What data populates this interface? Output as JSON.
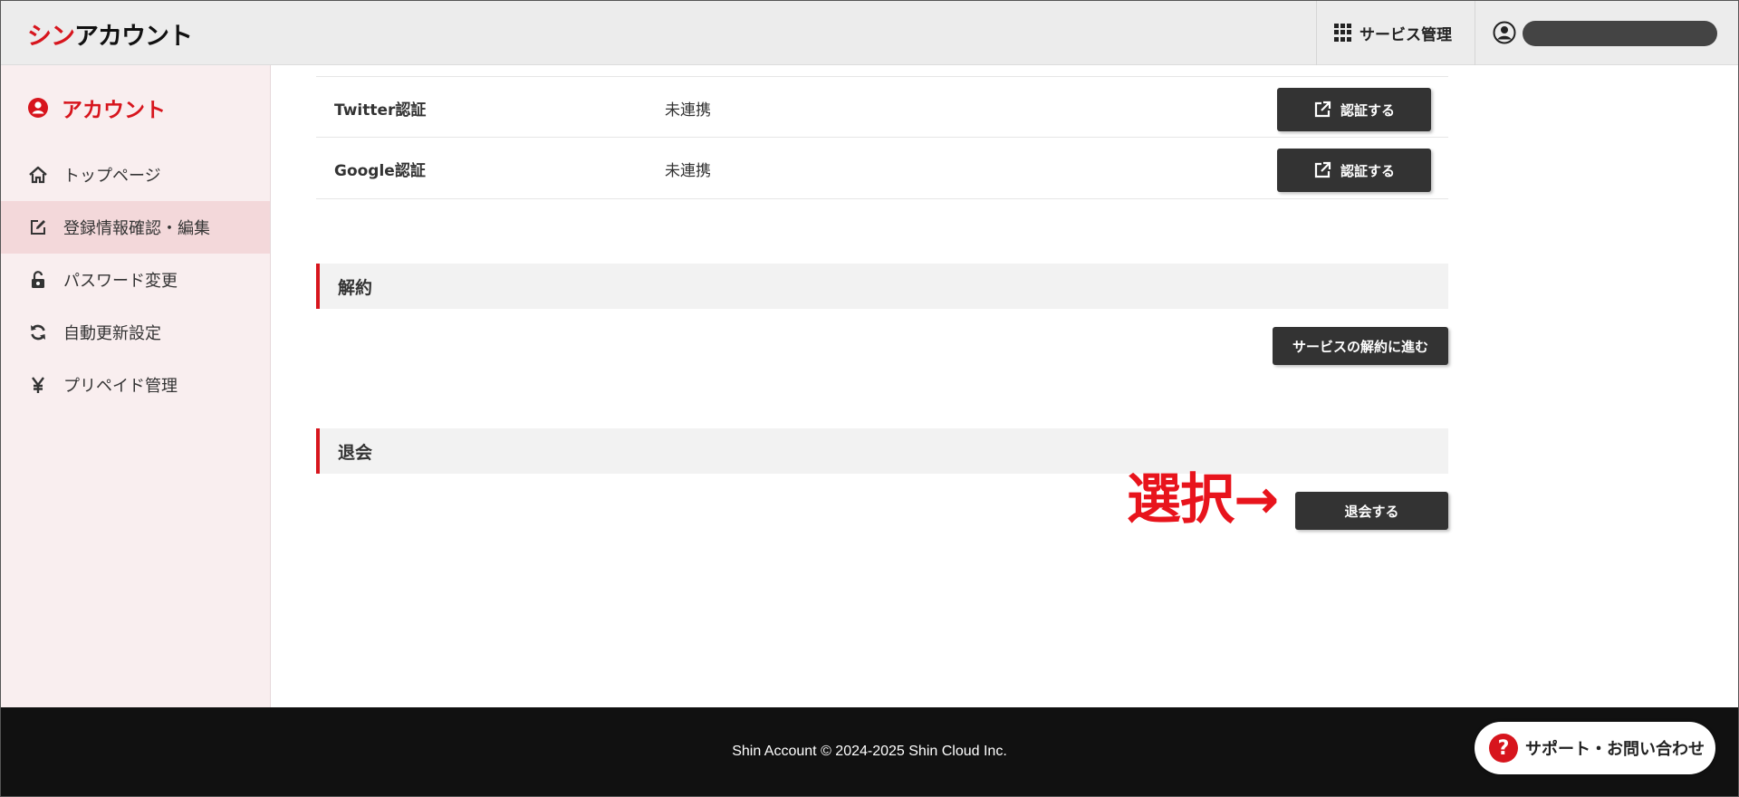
{
  "header": {
    "logo_red": "シン",
    "logo_black": "アカウント",
    "service_label": "サービス管理",
    "icons": [
      "grid-icon",
      "user-circle-icon"
    ]
  },
  "sidebar": {
    "title": "アカウント",
    "items": [
      {
        "label": "トップページ",
        "icon": "home-icon"
      },
      {
        "label": "登録情報確認・編集",
        "icon": "edit-icon",
        "active": true
      },
      {
        "label": "パスワード変更",
        "icon": "lock-icon"
      },
      {
        "label": "自動更新設定",
        "icon": "refresh-icon"
      },
      {
        "label": "プリペイド管理",
        "icon": "yen-icon"
      }
    ]
  },
  "main": {
    "auth_rows": [
      {
        "label": "Twitter認証",
        "status": "未連携",
        "button": "認証する"
      },
      {
        "label": "Google認証",
        "status": "未連携",
        "button": "認証する"
      }
    ],
    "cancel_section": {
      "title": "解約",
      "button": "サービスの解約に進む"
    },
    "withdraw_section": {
      "title": "退会",
      "button": "退会する"
    },
    "annotation": "選択→"
  },
  "footer": {
    "copyright": "Shin Account © 2024-2025 Shin Cloud Inc.",
    "support_label": "サポート・お問い合わせ",
    "support_icon": "?"
  },
  "colors": {
    "accent": "#d7151d",
    "sidebar_bg": "#f9eeef",
    "sidebar_active": "#f3d8da",
    "button_dark": "#333333",
    "footer_bg": "#111111"
  }
}
